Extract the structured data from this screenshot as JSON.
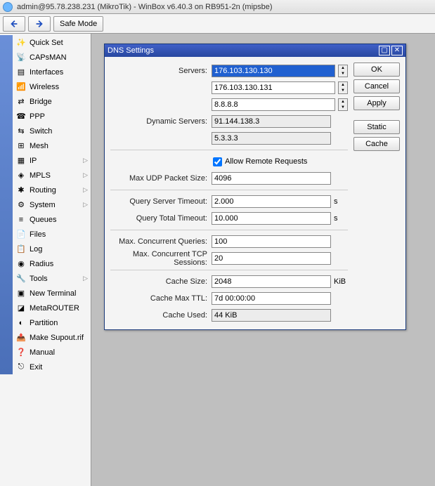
{
  "title": "admin@95.78.238.231 (MikroTik) - WinBox v6.40.3 on RB951-2n (mipsbe)",
  "toolbar": {
    "safe_mode": "Safe Mode"
  },
  "sidebar": {
    "items": [
      {
        "label": "Quick Set",
        "sub": false,
        "icon": "wand"
      },
      {
        "label": "CAPsMAN",
        "sub": false,
        "icon": "antenna"
      },
      {
        "label": "Interfaces",
        "sub": false,
        "icon": "eth"
      },
      {
        "label": "Wireless",
        "sub": false,
        "icon": "wifi"
      },
      {
        "label": "Bridge",
        "sub": false,
        "icon": "bridge"
      },
      {
        "label": "PPP",
        "sub": false,
        "icon": "ppp"
      },
      {
        "label": "Switch",
        "sub": false,
        "icon": "switch"
      },
      {
        "label": "Mesh",
        "sub": false,
        "icon": "mesh"
      },
      {
        "label": "IP",
        "sub": true,
        "icon": "ip"
      },
      {
        "label": "MPLS",
        "sub": true,
        "icon": "mpls"
      },
      {
        "label": "Routing",
        "sub": true,
        "icon": "routing"
      },
      {
        "label": "System",
        "sub": true,
        "icon": "system"
      },
      {
        "label": "Queues",
        "sub": false,
        "icon": "queues"
      },
      {
        "label": "Files",
        "sub": false,
        "icon": "files"
      },
      {
        "label": "Log",
        "sub": false,
        "icon": "log"
      },
      {
        "label": "Radius",
        "sub": false,
        "icon": "radius"
      },
      {
        "label": "Tools",
        "sub": true,
        "icon": "tools"
      },
      {
        "label": "New Terminal",
        "sub": false,
        "icon": "terminal"
      },
      {
        "label": "MetaROUTER",
        "sub": false,
        "icon": "meta"
      },
      {
        "label": "Partition",
        "sub": false,
        "icon": "partition"
      },
      {
        "label": "Make Supout.rif",
        "sub": false,
        "icon": "supout"
      },
      {
        "label": "Manual",
        "sub": false,
        "icon": "manual"
      },
      {
        "label": "Exit",
        "sub": false,
        "icon": "exit"
      }
    ]
  },
  "window": {
    "title": "DNS Settings",
    "buttons": {
      "ok": "OK",
      "cancel": "Cancel",
      "apply": "Apply",
      "static": "Static",
      "cache": "Cache"
    },
    "labels": {
      "servers": "Servers:",
      "dyn": "Dynamic Servers:",
      "allow_remote": "Allow Remote Requests",
      "max_udp": "Max UDP Packet Size:",
      "q_srv_to": "Query Server Timeout:",
      "q_tot_to": "Query Total Timeout:",
      "max_conc_q": "Max. Concurrent Queries:",
      "max_conc_tcp": "Max. Concurrent TCP Sessions:",
      "cache_size": "Cache Size:",
      "cache_max_ttl": "Cache Max TTL:",
      "cache_used": "Cache Used:"
    },
    "values": {
      "servers": [
        "176.103.130.130",
        "176.103.130.131",
        "8.8.8.8"
      ],
      "dyn_servers": [
        "91.144.138.3",
        "5.3.3.3"
      ],
      "allow_remote": true,
      "max_udp": "4096",
      "q_srv_to": "2.000",
      "q_tot_to": "10.000",
      "max_conc_q": "100",
      "max_conc_tcp": "20",
      "cache_size": "2048",
      "cache_max_ttl": "7d 00:00:00",
      "cache_used": "44 KiB"
    },
    "units": {
      "sec": "s",
      "kib": "KiB"
    }
  }
}
